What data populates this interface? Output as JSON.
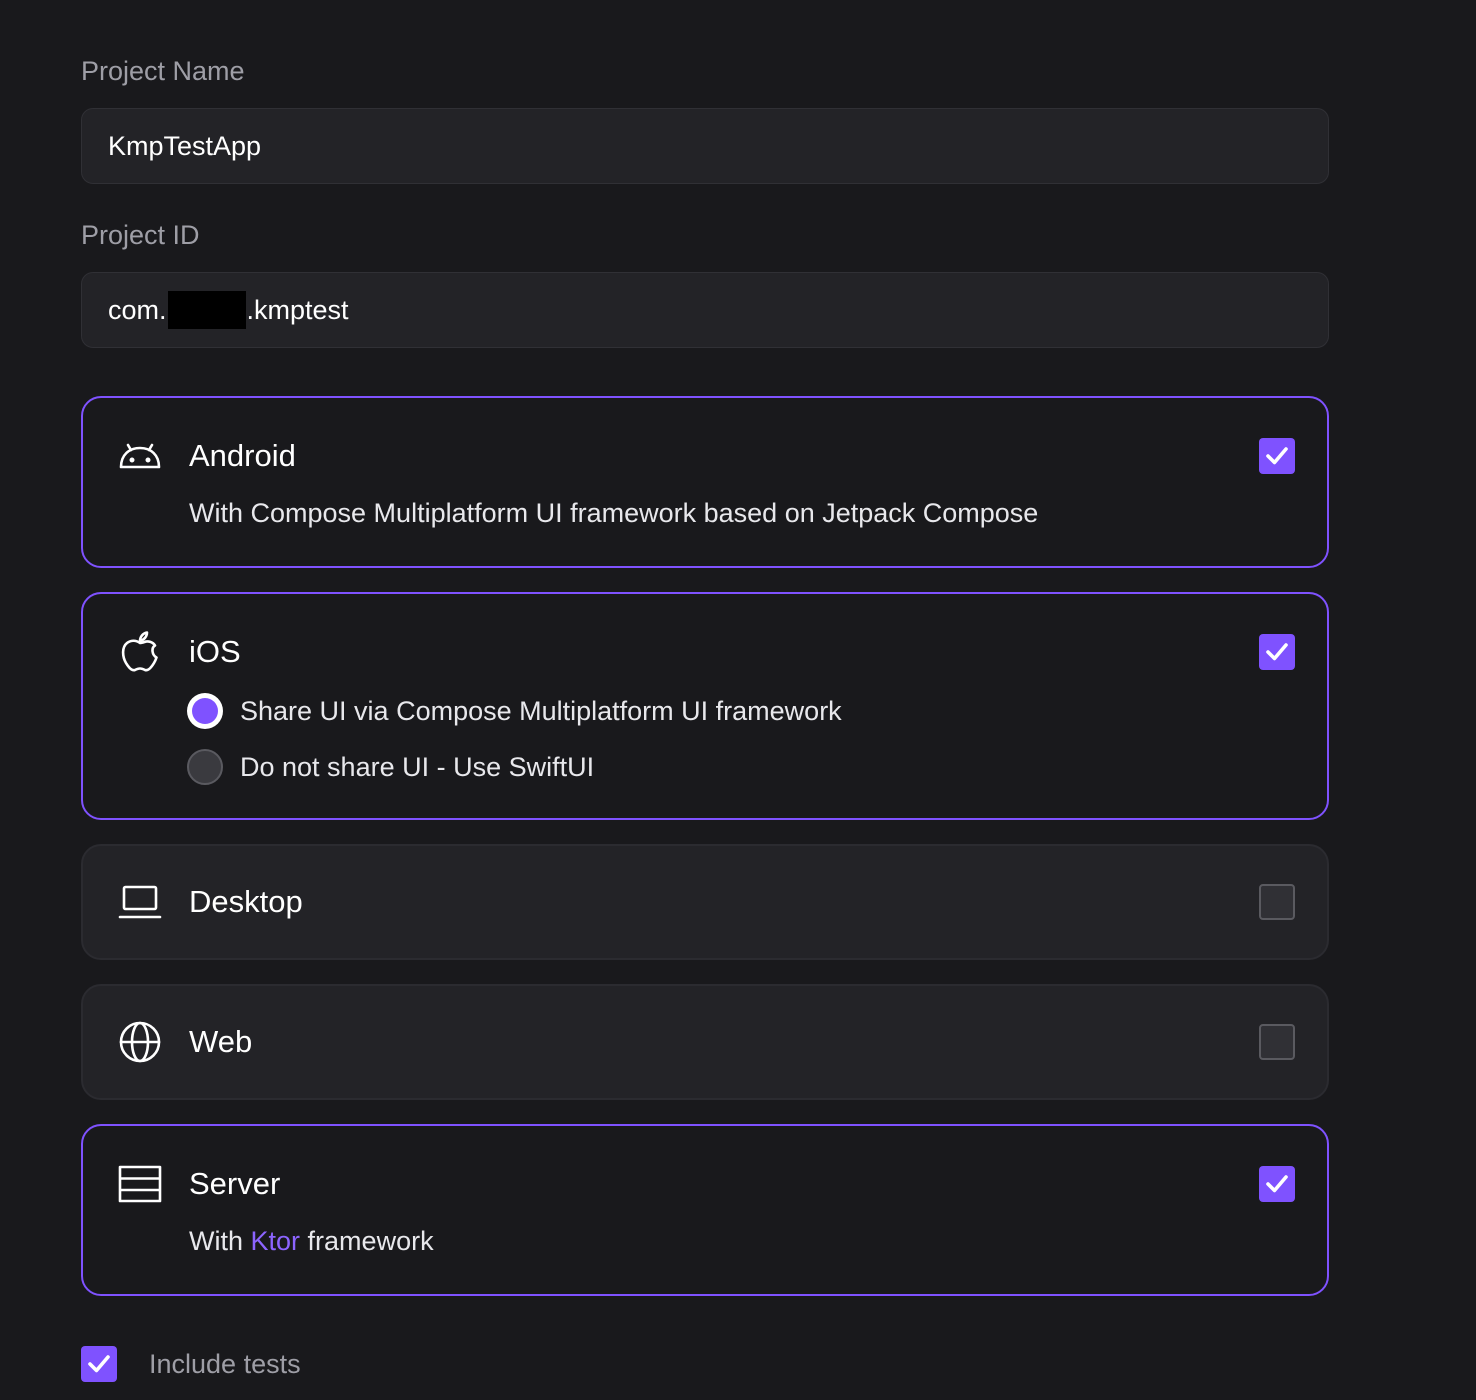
{
  "project_name": {
    "label": "Project Name",
    "value": "KmpTestApp"
  },
  "project_id": {
    "label": "Project ID",
    "prefix": "com.",
    "suffix": ".kmptest"
  },
  "platforms": {
    "android": {
      "title": "Android",
      "icon": "android-icon",
      "checked": true,
      "description": "With Compose Multiplatform UI framework based on Jetpack Compose"
    },
    "ios": {
      "title": "iOS",
      "icon": "apple-icon",
      "checked": true,
      "options": [
        {
          "label": "Share UI via Compose Multiplatform UI framework",
          "selected": true
        },
        {
          "label": "Do not share UI - Use SwiftUI",
          "selected": false
        }
      ]
    },
    "desktop": {
      "title": "Desktop",
      "icon": "laptop-icon",
      "checked": false
    },
    "web": {
      "title": "Web",
      "icon": "globe-icon",
      "checked": false
    },
    "server": {
      "title": "Server",
      "icon": "server-icon",
      "checked": true,
      "description_prefix": "With ",
      "description_link": "Ktor",
      "description_suffix": " framework"
    }
  },
  "include_tests": {
    "label": "Include tests",
    "checked": true
  },
  "colors": {
    "accent": "#7f52ff",
    "background": "#19191c",
    "field_background": "#232327",
    "muted_text": "#9e9ea6"
  }
}
